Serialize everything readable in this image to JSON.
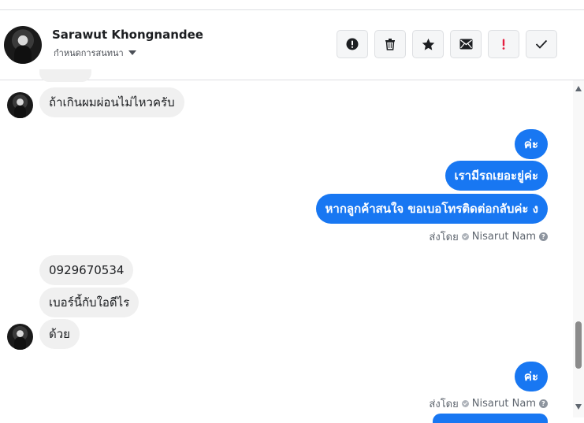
{
  "contact": {
    "name": "Sarawut Khongnandee",
    "subtitle": "กำหนดการสนทนา"
  },
  "toolbar": {
    "buttons": [
      {
        "icon": "alert-circle-icon"
      },
      {
        "icon": "trash-icon"
      },
      {
        "icon": "star-icon"
      },
      {
        "icon": "envelope-icon"
      },
      {
        "icon": "exclamation-icon"
      },
      {
        "icon": "checkmark-icon"
      }
    ]
  },
  "messages": [
    {
      "dir": "in",
      "text": "ถ้าเกินผมผ่อนไม่ไหวครับ"
    },
    {
      "dir": "out",
      "text": "ค่ะ"
    },
    {
      "dir": "out",
      "text": "เรามีรถเยอะยู่ค่ะ"
    },
    {
      "dir": "out",
      "text": "หากลูกค้าสนใจ ขอเบอโทรติดต่อกลับค่ะ ง"
    },
    {
      "dir": "in",
      "text": "0929670534"
    },
    {
      "dir": "in",
      "text": "เบอร์นี้กับใอดีไร"
    },
    {
      "dir": "in",
      "text": "ด้วย"
    },
    {
      "dir": "out",
      "text": "ค่ะ"
    }
  ],
  "sent_by": {
    "prefix": "ส่งโดย",
    "name": "Nisarut Nam",
    "help": "?"
  },
  "colors": {
    "outgoing_bubble": "#1877f2",
    "incoming_bubble": "#f0f0f0",
    "exclamation": "#e41e3f"
  }
}
